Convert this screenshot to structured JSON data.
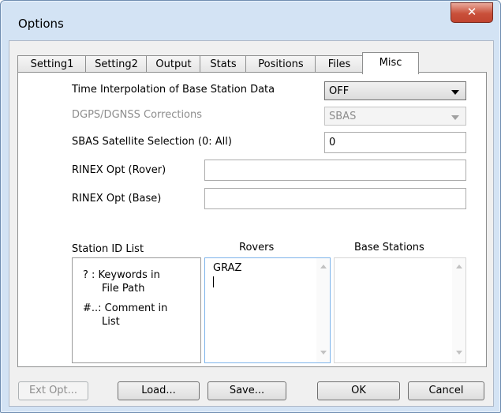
{
  "window": {
    "title": "Options",
    "close_glyph": "✕"
  },
  "tabs": [
    {
      "label": "Setting1"
    },
    {
      "label": "Setting2"
    },
    {
      "label": "Output"
    },
    {
      "label": "Stats"
    },
    {
      "label": "Positions"
    },
    {
      "label": "Files"
    },
    {
      "label": "Misc",
      "active": true
    }
  ],
  "misc": {
    "time_interp_label": "Time Interpolation of Base Station Data",
    "time_interp_value": "OFF",
    "dgps_label": "DGPS/DGNSS Corrections",
    "dgps_value": "SBAS",
    "sbas_label": "SBAS Satellite Selection (0: All)",
    "sbas_value": "0",
    "rinex_rover_label": "RINEX Opt (Rover)",
    "rinex_rover_value": "",
    "rinex_base_label": "RINEX Opt (Base)",
    "rinex_base_value": "",
    "station_list_label": "Station ID List",
    "help_line1a": "? : Keywords in",
    "help_line1b": "File Path",
    "help_line2a": "#..: Comment in",
    "help_line2b": "List",
    "rovers_label": "Rovers",
    "rovers_text": "GRAZ",
    "base_label": "Base Stations",
    "base_text": ""
  },
  "buttons": {
    "ext_opt": "Ext Opt...",
    "load": "Load...",
    "save": "Save...",
    "ok": "OK",
    "cancel": "Cancel"
  }
}
